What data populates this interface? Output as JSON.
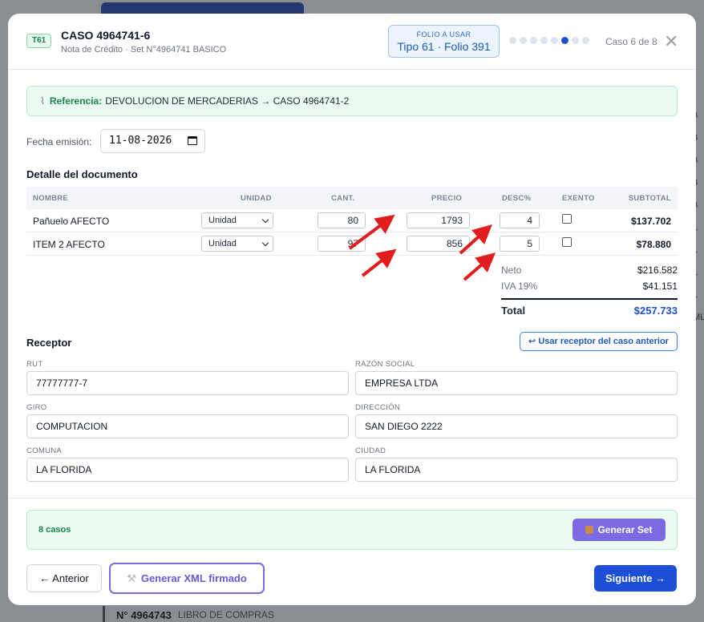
{
  "background": {
    "right_letters": [
      "3",
      "3",
      "3",
      "3",
      "3",
      "1",
      "1",
      "1",
      "1",
      "ML"
    ],
    "bottom_number": "N° 4964743",
    "bottom_label": "LIBRO DE COMPRAS"
  },
  "header": {
    "badge": "T61",
    "title": "CASO 4964741-6",
    "subtitle": "Nota de Crédito · Set N°4964741 BASICO",
    "folio_label": "FOLIO A USAR",
    "folio_value": "Tipo 61 · Folio 391",
    "case_count": "Caso 6 de 8",
    "close_icon": "close-icon",
    "total_steps": 8,
    "current_step": 6
  },
  "reference": {
    "icon": "paperclip-icon",
    "label": "Referencia:",
    "text": "DEVOLUCION DE MERCADERIAS → CASO 4964741-2"
  },
  "date": {
    "label": "Fecha emisión:",
    "value": "11-08-2026"
  },
  "detail": {
    "title": "Detalle del documento",
    "columns": {
      "nombre": "NOMBRE",
      "unidad": "UNIDAD",
      "cant": "CANT.",
      "precio": "PRECIO",
      "desc": "DESC%",
      "exento": "EXENTO",
      "subtotal": "SUBTOTAL"
    },
    "rows": [
      {
        "nombre": "Pañuelo AFECTO",
        "unidad": "Unidad",
        "cant": "80",
        "precio": "1793",
        "desc": "4",
        "exento": false,
        "subtotal": "$137.702"
      },
      {
        "nombre": "ITEM 2 AFECTO",
        "unidad": "Unidad",
        "cant": "97",
        "precio": "856",
        "desc": "5",
        "exento": false,
        "subtotal": "$78.880"
      }
    ]
  },
  "totals": {
    "neto_label": "Neto",
    "neto": "$216.582",
    "iva_label": "IVA 19%",
    "iva": "$41.151",
    "total_label": "Total",
    "total": "$257.733"
  },
  "receptor": {
    "title": "Receptor",
    "prev_button": "↩ Usar receptor del caso anterior",
    "rut_label": "RUT",
    "rut": "77777777-7",
    "razon_label": "RAZÓN SOCIAL",
    "razon": "EMPRESA LTDA",
    "giro_label": "GIRO",
    "giro": "COMPUTACION",
    "direccion_label": "DIRECCIÓN",
    "direccion": "SAN DIEGO 2222",
    "comuna_label": "COMUNA",
    "comuna": "LA FLORIDA",
    "ciudad_label": "CIUDAD",
    "ciudad": "LA FLORIDA"
  },
  "casos": {
    "text": "8 casos",
    "button": "Generar Set",
    "button_icon": "package-icon"
  },
  "footer": {
    "prev": "← Anterior",
    "xml": "Generar XML firmado",
    "xml_icon": "wrench-icon",
    "next": "Siguiente →"
  },
  "colors": {
    "accent": "#1d4ed8",
    "purple": "#7b6ae3",
    "green": "#16864a",
    "arrow": "#e11d1d"
  }
}
